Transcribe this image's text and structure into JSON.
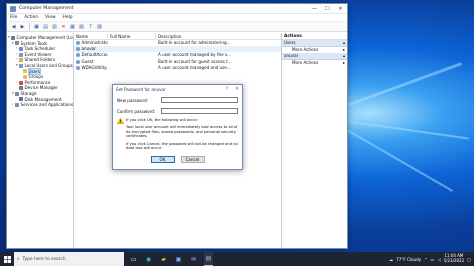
{
  "window": {
    "title": "Computer Management",
    "controls": [
      "—",
      "☐",
      "✕"
    ],
    "menu": [
      "File",
      "Action",
      "View",
      "Help"
    ]
  },
  "tree": [
    {
      "label": "Computer Management (Local",
      "depth": 0,
      "color": "#5b7fa8",
      "exp": "▾"
    },
    {
      "label": "System Tools",
      "depth": 1,
      "color": "#7a8aa0",
      "exp": "▾"
    },
    {
      "label": "Task Scheduler",
      "depth": 2,
      "color": "#6a8fc0",
      "exp": "›"
    },
    {
      "label": "Event Viewer",
      "depth": 2,
      "color": "#6aa0d0",
      "exp": "›"
    },
    {
      "label": "Shared Folders",
      "depth": 2,
      "color": "#e0b040",
      "exp": "›"
    },
    {
      "label": "Local Users and Groups",
      "depth": 2,
      "color": "#7a9cc8",
      "exp": "▾"
    },
    {
      "label": "Users",
      "depth": 3,
      "color": "#e0c060",
      "exp": "",
      "selected": true
    },
    {
      "label": "Groups",
      "depth": 3,
      "color": "#e0c060",
      "exp": ""
    },
    {
      "label": "Performance",
      "depth": 2,
      "color": "#d05050",
      "exp": "›"
    },
    {
      "label": "Device Manager",
      "depth": 2,
      "color": "#6a80a0",
      "exp": ""
    },
    {
      "label": "Storage",
      "depth": 1,
      "color": "#7a8aa0",
      "exp": "▾"
    },
    {
      "label": "Disk Management",
      "depth": 2,
      "color": "#5a70a0",
      "exp": ""
    },
    {
      "label": "Services and Applications",
      "depth": 1,
      "color": "#8090a8",
      "exp": "›"
    }
  ],
  "list": {
    "headers": [
      "Name",
      "Full Name",
      "Description"
    ],
    "rows": [
      {
        "name": "Administrator",
        "full": "",
        "desc": "Built-in account for administering..."
      },
      {
        "name": "anuvar",
        "full": "",
        "desc": "",
        "selected": true
      },
      {
        "name": "DefaultAccou...",
        "full": "",
        "desc": "A user account managed by the s..."
      },
      {
        "name": "Guest",
        "full": "",
        "desc": "Built-in account for guest access t..."
      },
      {
        "name": "WDAGUtility...",
        "full": "",
        "desc": "A user account managed and use..."
      }
    ]
  },
  "actions": {
    "header": "Actions",
    "sections": [
      {
        "label": "Users",
        "items": [
          "More Actions"
        ]
      },
      {
        "label": "anuvar",
        "items": [
          "More Actions"
        ]
      }
    ]
  },
  "dialog": {
    "title": "Set Password for anuvar",
    "help": "?",
    "close": "✕",
    "new_password_label": "New password:",
    "confirm_password_label": "Confirm password:",
    "warning_1": "If you click OK, the following will occur:",
    "warning_2": "Your local user account will immediately lose access to all of its encrypted files, stored passwords, and personal security certificates.",
    "warning_3": "If you click Cancel, the password will not be changed and no data loss will occur.",
    "ok": "OK",
    "cancel": "Cancel"
  },
  "taskbar": {
    "search_placeholder": "Type here to search",
    "weather": "77°F  Cloudy",
    "time": "11:04 AM",
    "date": "5/23/2022"
  }
}
